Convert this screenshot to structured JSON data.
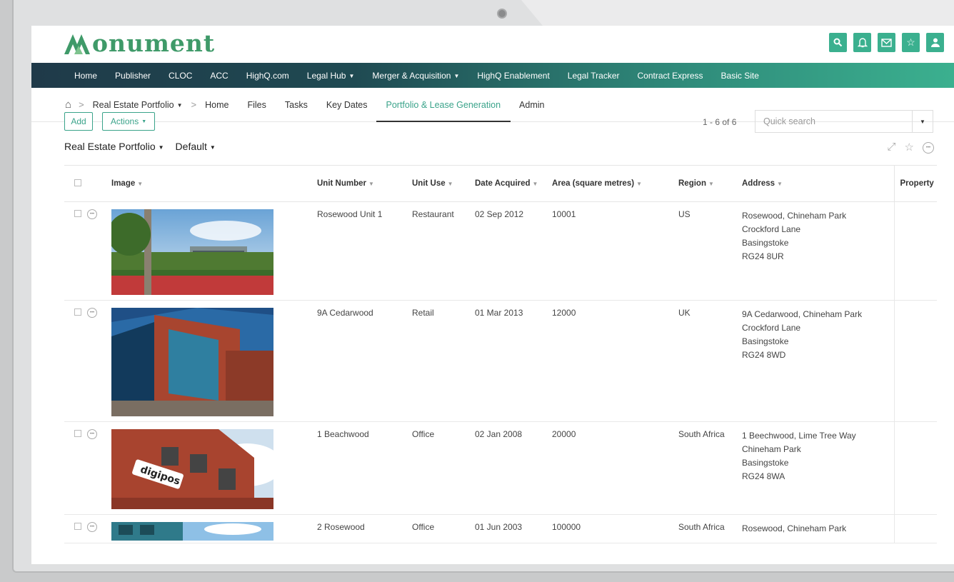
{
  "brand": {
    "name": "onument"
  },
  "header_icons": [
    "search-icon",
    "bell-icon",
    "mail-icon",
    "star-icon",
    "user-icon"
  ],
  "colors": {
    "accent": "#3bb08f",
    "brand_green": "#3f9a69",
    "nav_dark": "#1f3a49"
  },
  "topnav": [
    {
      "label": "Home"
    },
    {
      "label": "Publisher"
    },
    {
      "label": "CLOC"
    },
    {
      "label": "ACC"
    },
    {
      "label": "HighQ.com"
    },
    {
      "label": "Legal Hub",
      "dropdown": true
    },
    {
      "label": "Merger & Acquisition",
      "dropdown": true
    },
    {
      "label": "HighQ Enablement"
    },
    {
      "label": "Legal Tracker"
    },
    {
      "label": "Contract Express"
    },
    {
      "label": "Basic Site"
    }
  ],
  "breadcrumb": {
    "site": "Real Estate Portfolio"
  },
  "subnav": [
    "Home",
    "Files",
    "Tasks",
    "Key Dates",
    "Portfolio & Lease Generation",
    "Admin"
  ],
  "subnav_active": "Portfolio & Lease Generation",
  "toolbar": {
    "add_label": "Add",
    "actions_label": "Actions",
    "pager": "1 - 6 of 6",
    "search_placeholder": "Quick search"
  },
  "view": {
    "register": "Real Estate Portfolio",
    "view_name": "Default"
  },
  "table": {
    "columns": [
      "Image",
      "Unit Number",
      "Unit Use",
      "Date Acquired",
      "Area (square metres)",
      "Region",
      "Address",
      "Property"
    ],
    "rows": [
      {
        "unit": "Rosewood Unit 1",
        "use": "Restaurant",
        "date": "02 Sep 2012",
        "area": "10001",
        "region": "US",
        "address": [
          "Rosewood, Chineham Park",
          "Crockford Lane",
          "Basingstoke",
          "RG24 8UR"
        ]
      },
      {
        "unit": "9A Cedarwood",
        "use": "Retail",
        "date": "01 Mar 2013",
        "area": "12000",
        "region": "UK",
        "address": [
          "9A Cedarwood, Chineham Park",
          "Crockford Lane",
          "Basingstoke",
          "RG24 8WD"
        ]
      },
      {
        "unit": "1 Beachwood",
        "use": "Office",
        "date": "02 Jan 2008",
        "area": "20000",
        "region": "South Africa",
        "address": [
          "1 Beechwood, Lime Tree Way",
          "Chineham Park",
          "Basingstoke",
          "RG24 8WA"
        ]
      },
      {
        "unit": "2 Rosewood",
        "use": "Office",
        "date": "01 Jun 2003",
        "area": "100000",
        "region": "South Africa",
        "address": [
          "Rosewood, Chineham Park",
          "",
          "",
          ""
        ]
      }
    ],
    "image_sign_text": "digipos"
  }
}
